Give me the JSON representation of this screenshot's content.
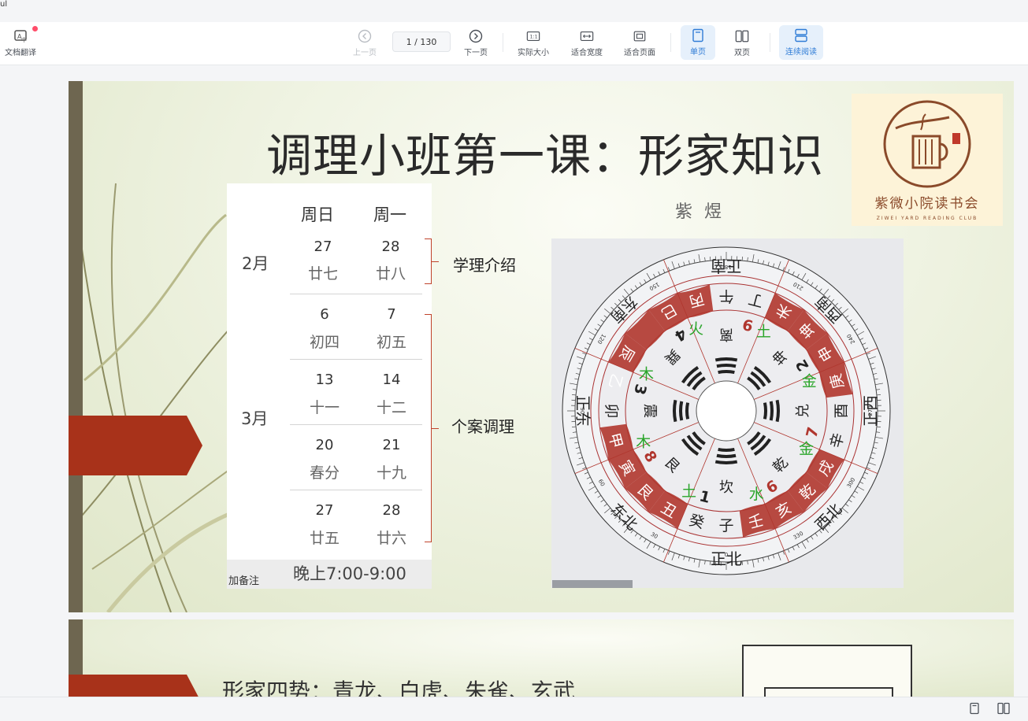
{
  "corner": "ul",
  "toolbar": {
    "translate_label": "文档翻译",
    "prev_label": "上一页",
    "page_indicator": "1  / 130",
    "next_label": "下一页",
    "actual_size_label": "实际大小",
    "fit_width_label": "适合宽度",
    "fit_page_label": "适合页面",
    "single_page_label": "单页",
    "double_page_label": "双页",
    "continuous_label": "连续阅读",
    "actual_size_icon_text": "1:1"
  },
  "slide1": {
    "title": "调理小班第一课：形家知识",
    "logo_text": "紫微小院读书会",
    "logo_sub": "ZIWEI YARD READING CLUB",
    "calendar": {
      "headers": [
        "周日",
        "周一"
      ],
      "months": [
        "2月",
        "3月"
      ],
      "rows": [
        {
          "sun": "27",
          "sun_lunar": "廿七",
          "mon": "28",
          "mon_lunar": "廿八"
        },
        {
          "sun": "6",
          "sun_lunar": "初四",
          "mon": "7",
          "mon_lunar": "初五"
        },
        {
          "sun": "13",
          "sun_lunar": "十一",
          "mon": "14",
          "mon_lunar": "十二"
        },
        {
          "sun": "20",
          "sun_lunar": "春分",
          "mon": "21",
          "mon_lunar": "十九"
        },
        {
          "sun": "27",
          "sun_lunar": "廿五",
          "mon": "28",
          "mon_lunar": "廿六"
        }
      ],
      "note": "加备注",
      "time": "晚上7:00-9:00"
    },
    "brace_labels": [
      "学理介绍",
      "个案调理"
    ],
    "compass_title": "紫 煜",
    "compass": {
      "directions": {
        "south": "正南",
        "north": "正北",
        "east": "正东",
        "west": "正西",
        "ne": "东北",
        "nw": "西北",
        "se": "东南",
        "sw": "西南"
      },
      "ring_red": [
        "丙",
        "巳",
        "辰",
        "乙",
        "甲",
        "寅",
        "艮",
        "丑",
        "壬",
        "亥",
        "乾",
        "戌",
        "庚",
        "申",
        "坤",
        "未"
      ],
      "ring_plain": [
        "午",
        "丁",
        "卯",
        "子",
        "癸",
        "酉",
        "辛"
      ],
      "trigrams": [
        "离",
        "坤",
        "兑",
        "乾",
        "坎",
        "艮",
        "震",
        "巽"
      ],
      "numbers": [
        "9",
        "2",
        "7",
        "6",
        "1",
        "8",
        "3",
        "4"
      ],
      "elements": [
        "火",
        "土",
        "金",
        "金",
        "水",
        "土",
        "木",
        "木"
      ],
      "degree_ticks": [
        "0",
        "30",
        "60",
        "90",
        "120",
        "150",
        "180",
        "210",
        "240",
        "270",
        "300",
        "330"
      ]
    }
  },
  "slide2": {
    "title": "形家四势：青龙、白虎、朱雀、玄武"
  },
  "colors": {
    "accent": "#2f7cd6",
    "slide_red": "#a8321a",
    "compass_red": "#b0362e",
    "element_green": "#2aa52a"
  }
}
